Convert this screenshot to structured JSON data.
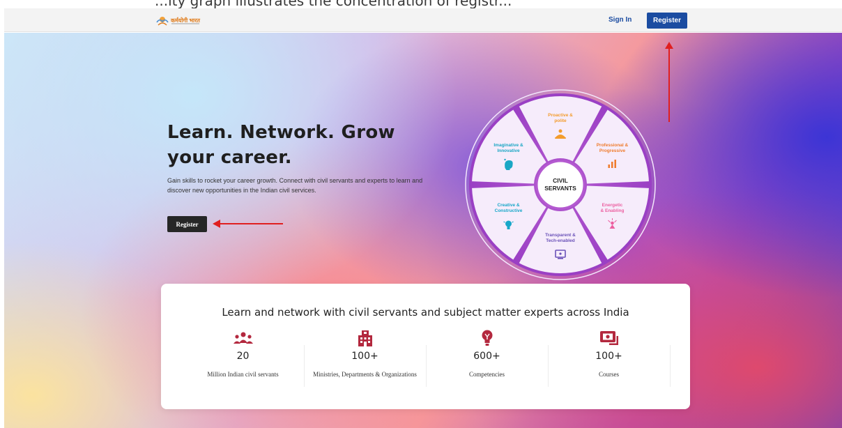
{
  "browser_strip": {
    "text": "...ity graph illustrates the concentration of registr..."
  },
  "nav": {
    "logo_text": "कर्मयोगी भारत",
    "signin_label": "Sign In",
    "register_label": "Register"
  },
  "hero": {
    "headline": "Learn. Network. Grow your career.",
    "subtext": "Gain skills to rocket your career growth. Connect with civil servants and experts to learn and discover new opportunities in the Indian civil services.",
    "register_label": "Register"
  },
  "wheel": {
    "center_line1": "CIVIL",
    "center_line2": "SERVANTS",
    "segments": [
      {
        "line1": "Proactive &",
        "line2": "polite",
        "color": "#f39c2c",
        "icon": "meditation-icon"
      },
      {
        "line1": "Professional &",
        "line2": "Progressive",
        "color": "#ef7b2b",
        "icon": "bar-chart-icon"
      },
      {
        "line1": "Energetic",
        "line2": "& Enabling",
        "color": "#ec5fa0",
        "icon": "person-star-icon"
      },
      {
        "line1": "Transparent &",
        "line2": "Tech-enabled",
        "color": "#6a51b8",
        "icon": "monitor-icon"
      },
      {
        "line1": "Creative &",
        "line2": "Constructive",
        "color": "#17a7c9",
        "icon": "bulb-icon"
      },
      {
        "line1": "Imaginative &",
        "line2": "Innovative",
        "color": "#1aa6c4",
        "icon": "brain-icon"
      }
    ]
  },
  "stats": {
    "title": "Learn and network with civil servants and subject matter experts across India",
    "icon_color": "#b3283e",
    "items": [
      {
        "value": "20",
        "label": "Million Indian civil servants",
        "icon": "people-group-icon"
      },
      {
        "value": "100+",
        "label": "Ministries, Departments & Organizations",
        "icon": "building-icon"
      },
      {
        "value": "600+",
        "label": "Competencies",
        "icon": "lightbulb-icon"
      },
      {
        "value": "100+",
        "label": "Courses",
        "icon": "course-screen-icon"
      }
    ]
  },
  "annotation_color": "#e01f1f"
}
